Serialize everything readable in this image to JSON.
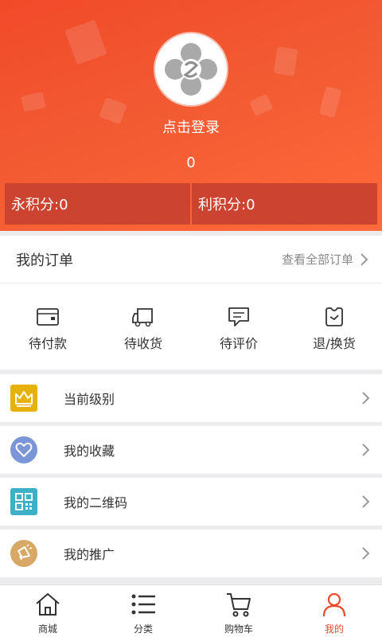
{
  "profile": {
    "login_label": "点击登录",
    "count": "0",
    "points": [
      {
        "label": "永积分:0"
      },
      {
        "label": "利积分:0"
      }
    ]
  },
  "orders": {
    "title": "我的订单",
    "view_all": "查看全部订单",
    "items": [
      {
        "label": "待付款",
        "icon": "wallet-icon"
      },
      {
        "label": "待收货",
        "icon": "truck-icon"
      },
      {
        "label": "待评价",
        "icon": "comment-icon"
      },
      {
        "label": "退/换货",
        "icon": "return-icon"
      }
    ]
  },
  "menu": [
    {
      "label": "当前级别",
      "icon": "crown-icon",
      "color": "#e5b10a"
    },
    {
      "label": "我的收藏",
      "icon": "heart-icon",
      "color": "#7b96d6"
    },
    {
      "label": "我的二维码",
      "icon": "qrcode-icon",
      "color": "#3db0c7"
    },
    {
      "label": "我的推广",
      "icon": "megaphone-icon",
      "color": "#d8a866"
    }
  ],
  "nav": [
    {
      "label": "商城",
      "icon": "home-icon"
    },
    {
      "label": "分类",
      "icon": "list-icon"
    },
    {
      "label": "购物车",
      "icon": "cart-icon"
    },
    {
      "label": "我的",
      "icon": "user-icon",
      "active": true
    }
  ],
  "colors": {
    "accent": "#e84b2b",
    "header": "#f25a32",
    "points_box": "#cc4430"
  }
}
